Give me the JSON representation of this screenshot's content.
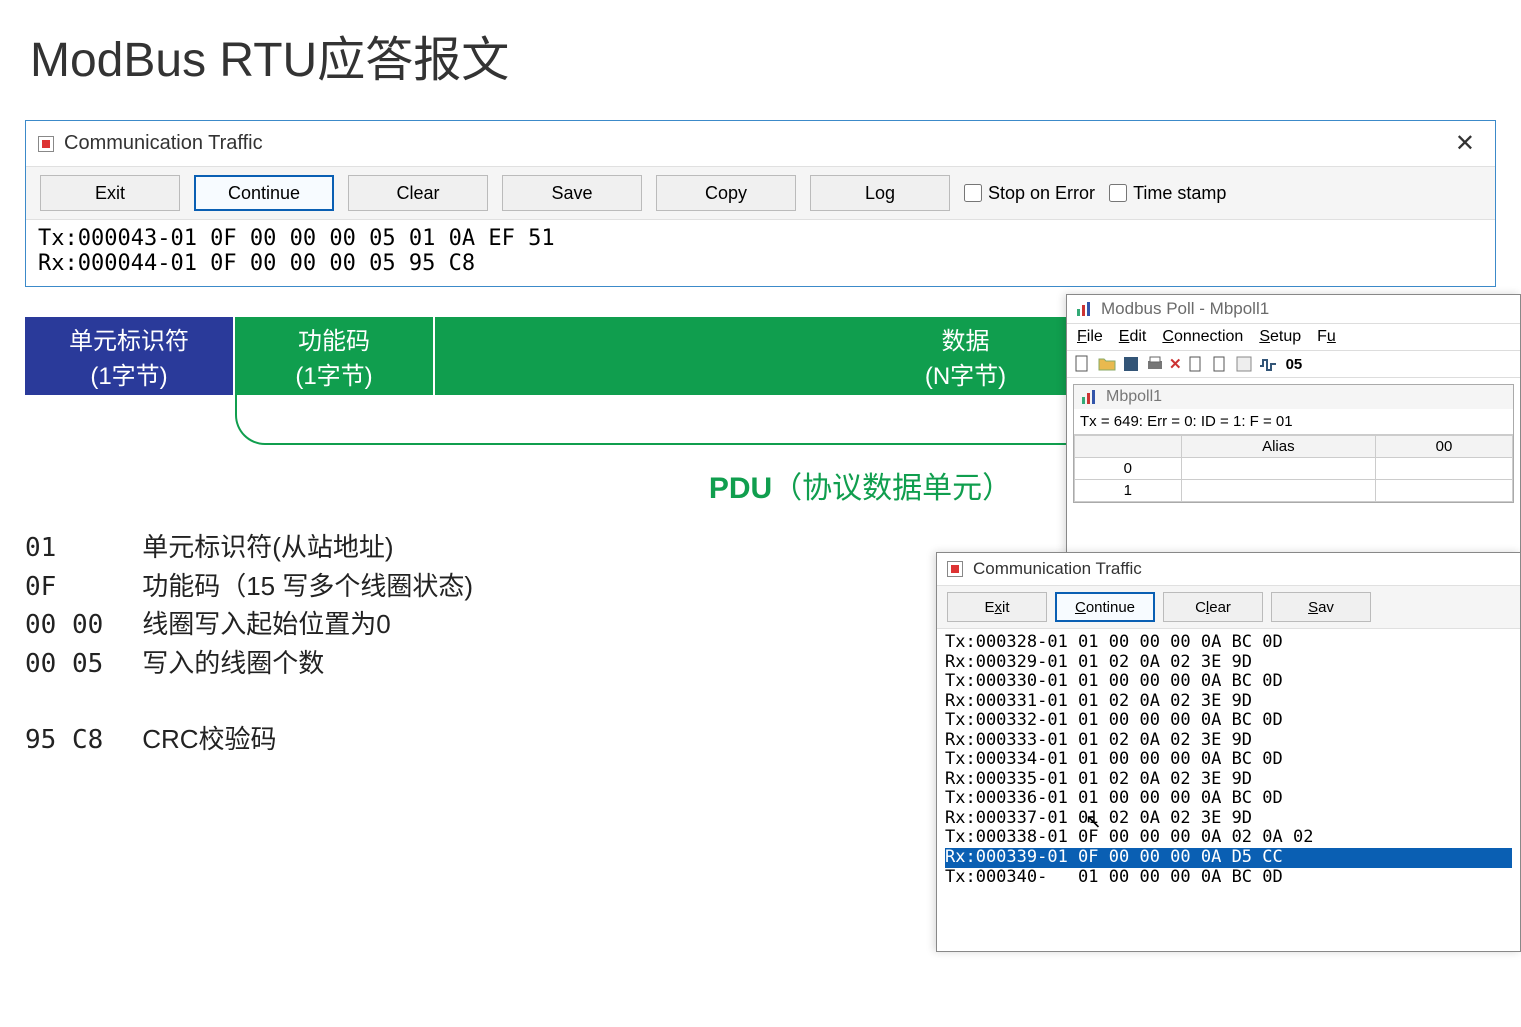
{
  "title": "ModBus RTU应答报文",
  "window1": {
    "title": "Communication Traffic",
    "buttons": {
      "exit": "Exit",
      "continue": "Continue",
      "clear": "Clear",
      "save": "Save",
      "copy": "Copy",
      "log": "Log"
    },
    "checks": {
      "stopOnError": "Stop on Error",
      "timeStamp": "Time stamp"
    },
    "lines": [
      "Tx:000043-01 0F 00 00 00 05 01 0A EF 51",
      "Rx:000044-01 0F 00 00 00 05 95 C8"
    ]
  },
  "pdu": {
    "unit": {
      "t1": "单元标识符",
      "t2": "(1字节)"
    },
    "func": {
      "t1": "功能码",
      "t2": "(1字节)"
    },
    "data": {
      "t1": "数据",
      "t2": "(N字节)"
    },
    "label_bold": "PDU",
    "label_paren": "（协议数据单元）"
  },
  "explain": [
    {
      "code": "01",
      "text": "单元标识符(从站地址)"
    },
    {
      "code": "0F",
      "text": "功能码（15 写多个线圈状态)"
    },
    {
      "code": "00 00",
      "text": "线圈写入起始位置为0"
    },
    {
      "code": "00 05",
      "text": "写入的线圈个数"
    },
    {
      "code": "",
      "text": ""
    },
    {
      "code": "95 C8",
      "text": "CRC校验码"
    }
  ],
  "mbpoll": {
    "title": "Modbus Poll - Mbpoll1",
    "menu": {
      "file": "File",
      "edit": "Edit",
      "connection": "Connection",
      "setup": "Setup",
      "fun": "Fu"
    },
    "docTitle": "Mbpoll1",
    "status": "Tx = 649: Err = 0: ID = 1: F = 01",
    "colAlias": "Alias",
    "col00": "00",
    "rows": [
      "0",
      "1"
    ],
    "tool05": "05"
  },
  "comm2": {
    "title": "Communication Traffic",
    "buttons": {
      "exit": "Exit",
      "continue": "Continue",
      "clear": "Clear",
      "save": "Sav"
    },
    "lines": [
      "Tx:000328-01 01 00 00 00 0A BC 0D",
      "Rx:000329-01 01 02 0A 02 3E 9D",
      "Tx:000330-01 01 00 00 00 0A BC 0D",
      "Rx:000331-01 01 02 0A 02 3E 9D",
      "Tx:000332-01 01 00 00 00 0A BC 0D",
      "Rx:000333-01 01 02 0A 02 3E 9D",
      "Tx:000334-01 01 00 00 00 0A BC 0D",
      "Rx:000335-01 01 02 0A 02 3E 9D",
      "Tx:000336-01 01 00 00 00 0A BC 0D",
      "Rx:000337-01 01 02 0A 02 3E 9D",
      "Tx:000338-01 0F 00 00 00 0A 02 0A 02",
      "Rx:000339-01 0F 00 00 00 0A D5 CC",
      "Tx:000340-   01 00 00 00 0A BC 0D"
    ],
    "highlight_index": 11
  }
}
